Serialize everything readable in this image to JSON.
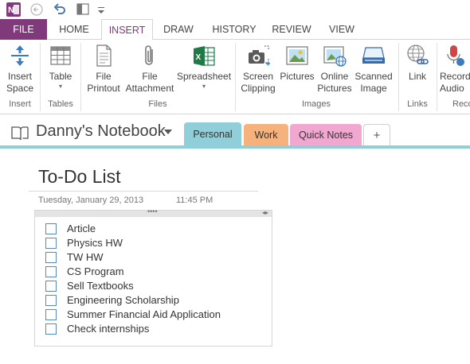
{
  "quick_access": {
    "icons": [
      "onenote-logo-icon",
      "back-icon",
      "undo-icon",
      "dock-icon",
      "customize-icon"
    ]
  },
  "ribbon_tabs": {
    "file": "FILE",
    "home": "HOME",
    "insert": "INSERT",
    "draw": "DRAW",
    "history": "HISTORY",
    "review": "REVIEW",
    "view": "VIEW",
    "active": "INSERT"
  },
  "ribbon": {
    "insert_space": [
      "Insert",
      "Space"
    ],
    "table": "Table",
    "file_printout": [
      "File",
      "Printout"
    ],
    "file_attachment": [
      "File",
      "Attachment"
    ],
    "spreadsheet": "Spreadsheet",
    "screen_clipping": [
      "Screen",
      "Clipping"
    ],
    "pictures": "Pictures",
    "online_pictures": [
      "Online",
      "Pictures"
    ],
    "scanned_image": [
      "Scanned",
      "Image"
    ],
    "link": "Link",
    "record_audio": [
      "Record",
      "Audio"
    ],
    "groups": {
      "insert": "Insert",
      "tables": "Tables",
      "files": "Files",
      "images": "Images",
      "links": "Links",
      "recording": "Reco"
    }
  },
  "notebook": {
    "name": "Danny's Notebook",
    "sections": [
      "Personal",
      "Work",
      "Quick Notes"
    ],
    "active_section": "Personal",
    "add_section": "+"
  },
  "page": {
    "title": "To-Do List",
    "date": "Tuesday, January 29, 2013",
    "time": "11:45 PM",
    "handle_dots": "••••",
    "resize_arrows": "◂▸",
    "todos": [
      {
        "text": "Article",
        "checked": false
      },
      {
        "text": "Physics HW",
        "checked": false
      },
      {
        "text": "TW HW",
        "checked": false
      },
      {
        "text": "CS Program",
        "checked": false
      },
      {
        "text": "Sell Textbooks",
        "checked": false
      },
      {
        "text": "Engineering Scholarship",
        "checked": false
      },
      {
        "text": "Summer Financial Aid Application",
        "checked": false
      },
      {
        "text": "Check internships",
        "checked": false
      }
    ]
  },
  "colors": {
    "file_tab": "#80397b",
    "personal": "#8fcfd9",
    "work": "#f5b27c",
    "quick_notes": "#f0a8d0",
    "checkbox_border": "#5a88b8"
  }
}
